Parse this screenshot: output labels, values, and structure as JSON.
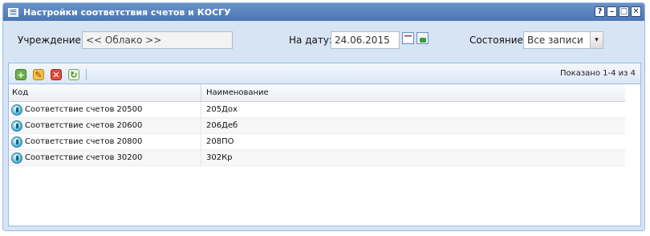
{
  "window": {
    "title": "Настройки соответствия счетов и КОСГУ",
    "tools": [
      "?",
      "–",
      "□",
      "✕"
    ]
  },
  "filters": {
    "institution_label": "Учреждение:",
    "institution_value": "<< Облако >>",
    "date_label": "На дату:",
    "date_value": "24.06.2015",
    "state_label": "Состояние:",
    "state_value": "Все записи",
    "state_dropdown_glyph": "▾"
  },
  "toolbar": {
    "add_glyph": "+",
    "edit_glyph": "✎",
    "delete_glyph": "✕",
    "refresh_glyph": "↻",
    "paging_info": "Показано 1-4 из 4"
  },
  "grid": {
    "columns": [
      "Код",
      "Наименование"
    ],
    "rows": [
      {
        "code": "Соответствие счетов 20500",
        "name": "205Дох"
      },
      {
        "code": "Соответствие счетов 20600",
        "name": "206Деб"
      },
      {
        "code": "Соответствие счетов 20800",
        "name": "208ПО"
      },
      {
        "code": "Соответствие счетов 30200",
        "name": "302Кр"
      }
    ]
  }
}
